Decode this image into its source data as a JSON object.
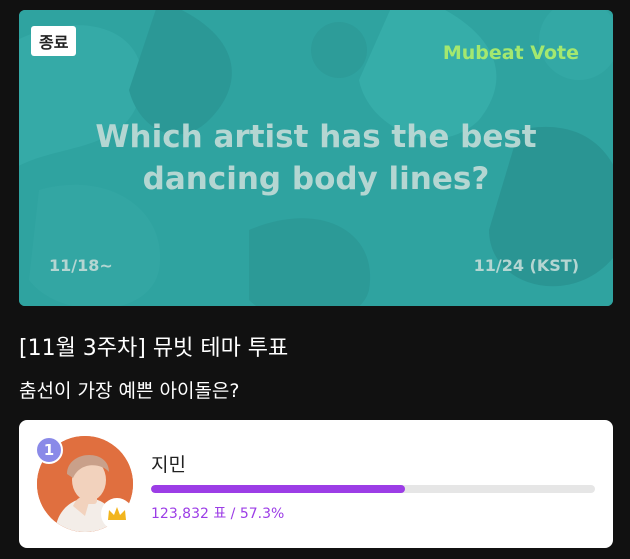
{
  "banner": {
    "status_badge": "종료",
    "brand": "Mubeat Vote",
    "question": "Which artist has the best dancing body lines?",
    "start_date": "11/18~",
    "end_date": "11/24 (KST)",
    "background_color": "#2fa3a0"
  },
  "vote": {
    "title": "[11월 3주차] 뮤빗 테마 투표",
    "subtitle": "춤선이 가장 예쁜 아이돌은?"
  },
  "results": [
    {
      "rank": "1",
      "name": "지민",
      "stats": "123,832 표 / 57.3%",
      "percent": 57.3,
      "accent_color": "#9c3de6",
      "badge": "crown-icon"
    }
  ]
}
